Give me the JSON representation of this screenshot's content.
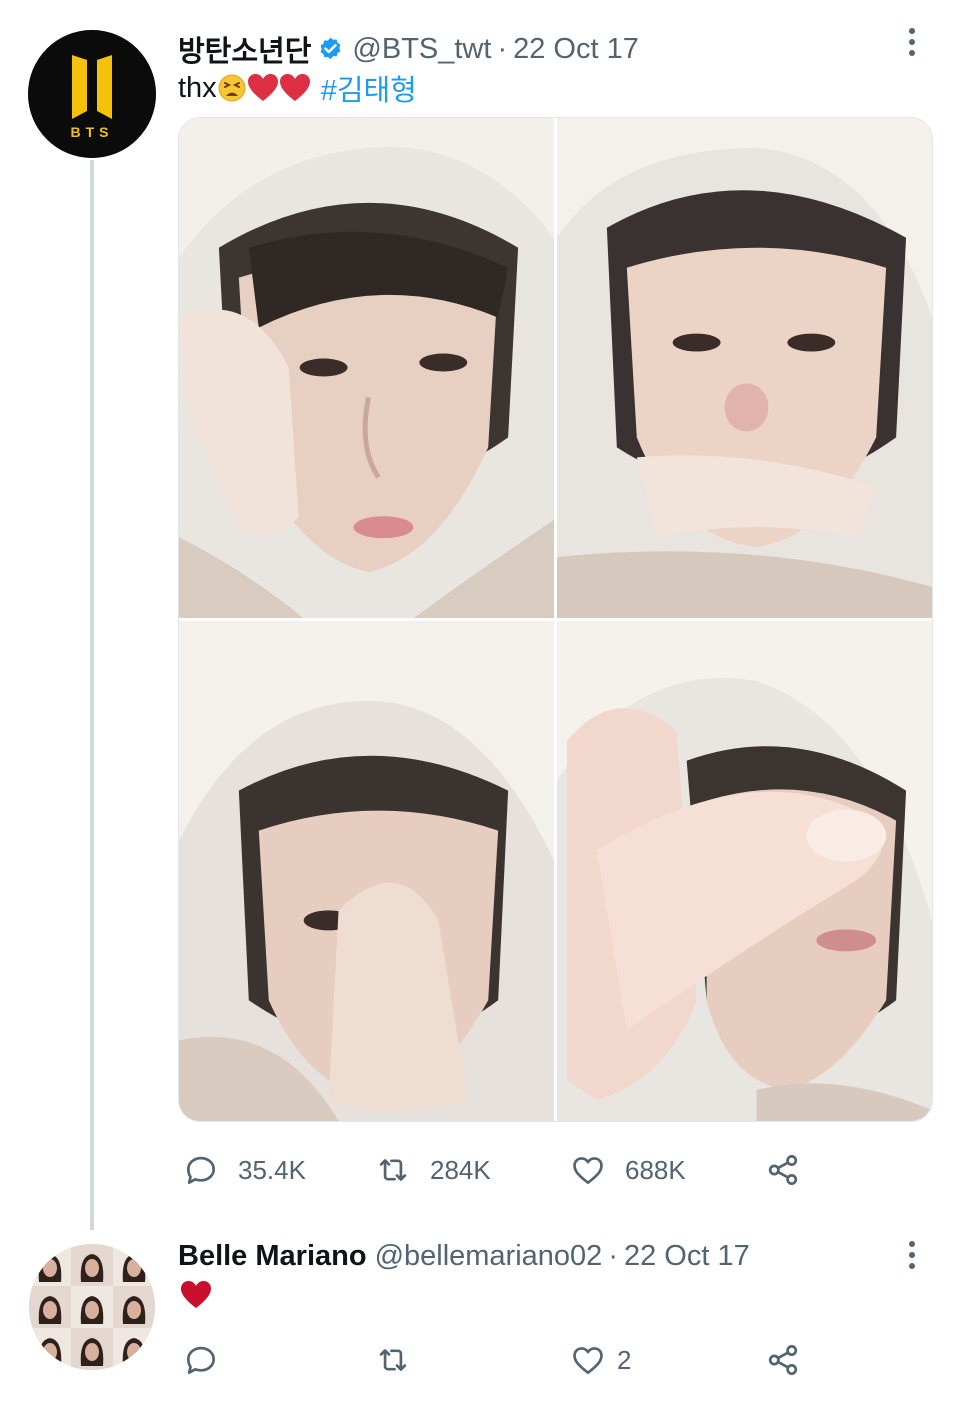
{
  "tweet": {
    "display_name": "방탄소년단",
    "handle": "@BTS_twt",
    "separator": "·",
    "date": "22 Oct 17",
    "text": "thx",
    "emojis": [
      "weary-face",
      "red-heart",
      "red-heart"
    ],
    "hashtag": "#김태형",
    "avatar_logo": "BTS",
    "media": [
      {
        "name": "photo-1"
      },
      {
        "name": "photo-2"
      },
      {
        "name": "photo-3"
      },
      {
        "name": "photo-4"
      }
    ],
    "stats": {
      "replies": "35.4K",
      "retweets": "284K",
      "likes": "688K"
    }
  },
  "reply": {
    "display_name": "Belle Mariano",
    "handle": "@bellemariano02",
    "separator": "·",
    "date": "22 Oct 17",
    "text_emoji": "red-heart",
    "stats": {
      "likes": "2"
    }
  },
  "colors": {
    "hashtag": "#1d9bf0",
    "verified": "#1d9bf0",
    "heart": "#e0245e",
    "muted": "#536471",
    "logo_gold": "#f4c20d"
  }
}
